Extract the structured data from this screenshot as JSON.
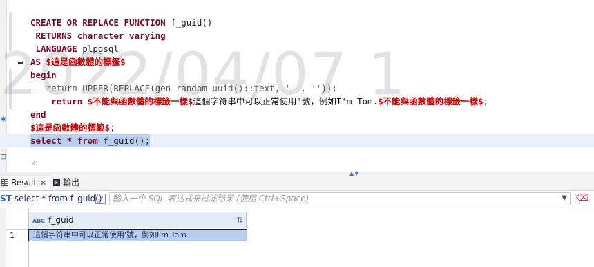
{
  "editor": {
    "lines": [
      {
        "parts": [
          {
            "t": "CREATE OR REPLACE FUNCTION ",
            "c": "kw"
          },
          {
            "t": "f_guid()",
            "c": "fn"
          }
        ]
      },
      {
        "parts": [
          {
            "t": " RETURNS character varying",
            "c": "kw"
          }
        ]
      },
      {
        "parts": [
          {
            "t": " LANGUAGE ",
            "c": "kw"
          },
          {
            "t": "plpgsql",
            "c": "fn"
          }
        ]
      },
      {
        "parts": [
          {
            "t": "AS ",
            "c": "kw"
          },
          {
            "t": "$這是函數體的標籤$",
            "c": "str"
          }
        ]
      },
      {
        "parts": [
          {
            "t": "begin",
            "c": "kw"
          }
        ]
      },
      {
        "parts": [
          {
            "t": "-- return UPPER(REPLACE(gen_random_uuid()::text, '-', ''));",
            "c": "cmt"
          }
        ]
      },
      {
        "parts": [
          {
            "t": "    return ",
            "c": "kw"
          },
          {
            "t": "$不能與函數體的標籤一樣$",
            "c": "str"
          },
          {
            "t": "這個字符串中可以正常使用'號，例如I'm Tom.",
            "c": "cjk"
          },
          {
            "t": "$不能與函數體的標籤一樣$",
            "c": "str"
          },
          {
            "t": ";",
            "c": "fn"
          }
        ]
      },
      {
        "parts": [
          {
            "t": "end",
            "c": "kw"
          }
        ]
      },
      {
        "parts": [
          {
            "t": "$這是函數體的標籤$",
            "c": "str"
          },
          {
            "t": ";",
            "c": "fn"
          }
        ]
      },
      {
        "parts": [
          {
            "t": "select * from ",
            "c": "kw"
          },
          {
            "t": "f_guid();",
            "c": "fn"
          }
        ],
        "selected": true
      }
    ],
    "watermark": "2022/04/07 1"
  },
  "tabs": {
    "result_label": "Result",
    "result_close": "✕",
    "output_label": "輸出"
  },
  "filterbar": {
    "query_text": "select * from f_guid()",
    "query_prefix": "ST",
    "placeholder": "輸入一个 SQL 表达式来过滤结果 (使用 Ctrl+Space)"
  },
  "grid": {
    "columns": [
      {
        "name": "f_guid",
        "type_badge": "ABC"
      }
    ],
    "rows": [
      {
        "num": "1",
        "values": [
          "這個字符串中可以正常使用'號，例如I'm Tom."
        ]
      }
    ]
  },
  "colors": {
    "keyword": "#7a0a2a",
    "dollar_string": "#d00000",
    "selection": "#b7d0ef",
    "header_bg": "#e4ebf5"
  }
}
